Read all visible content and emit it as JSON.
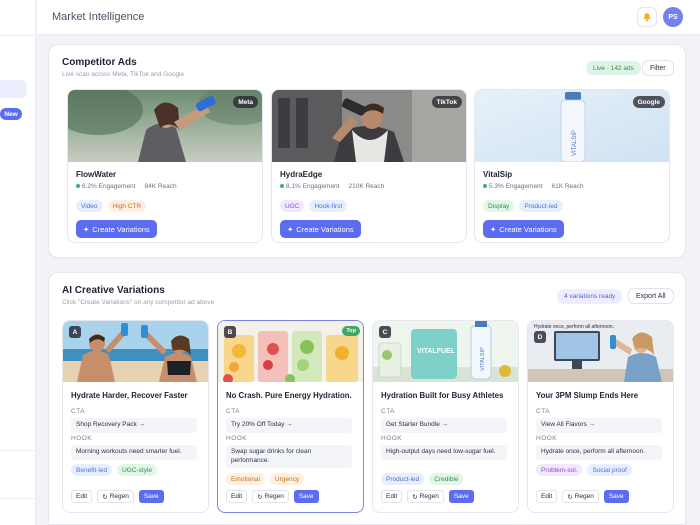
{
  "sidebar": {
    "new_badge": "New"
  },
  "header": {
    "title": "Market Intelligence",
    "avatar_initials": "PS",
    "bell_icon": "bell-icon"
  },
  "competitor_ads": {
    "title": "Competitor Ads",
    "subtitle": "Live scan across Meta, TikTok and Google",
    "live_badge": "Live · 142 ads",
    "filter_label": "Filter",
    "cards": [
      {
        "platform": "Meta",
        "brand": "FlowWater",
        "engagement": "6.2% Engagement",
        "reach": "84K Reach",
        "tags": [
          "Video",
          "High CTR"
        ],
        "cta": "Create Variations"
      },
      {
        "platform": "TikTok",
        "brand": "HydraEdge",
        "engagement": "8.1% Engagement",
        "reach": "210K Reach",
        "tags": [
          "UGC",
          "Hook-first"
        ],
        "cta": "Create Variations"
      },
      {
        "platform": "Google",
        "brand": "VitalSip",
        "engagement": "5.3% Engagement",
        "reach": "61K Reach",
        "tags": [
          "Display",
          "Product-led"
        ],
        "cta": "Create Variations"
      }
    ]
  },
  "variations": {
    "title": "AI Creative Variations",
    "subtitle": "Click \"Create Variations\" on any competitor ad above",
    "count_badge": "4 variations ready",
    "export_label": "Export All",
    "cta_label": "CTA",
    "hook_label": "HOOK",
    "edit_label": "Edit",
    "regen_label": "Regen",
    "save_label": "Save",
    "top_badge": "Top",
    "cards": [
      {
        "letter": "A",
        "headline": "Hydrate Harder, Recover Faster",
        "cta": "Shop Recovery Pack →",
        "hook": "Morning workouts need smarter fuel.",
        "tags": [
          "Benefit-led",
          "UGC-style"
        ]
      },
      {
        "letter": "B",
        "headline": "No Crash. Pure Energy Hydration.",
        "cta": "Try 20% Off Today →",
        "hook": "Swap sugar drinks for clean performance.",
        "tags": [
          "Emotional",
          "Urgency"
        ]
      },
      {
        "letter": "C",
        "headline": "Hydration Built for Busy Athletes",
        "cta": "Get Starter Bundle →",
        "hook": "High-output days need low-sugar fuel.",
        "tags": [
          "Product-led",
          "Credible"
        ],
        "image_text_1": "VITALFUEL",
        "image_text_2": "VITALSIP"
      },
      {
        "letter": "D",
        "headline": "Your 3PM Slump Ends Here",
        "cta": "View All Flavors →",
        "hook": "Hydrate once, perform all afternoon.",
        "tags": [
          "Problem-sol.",
          "Social proof"
        ],
        "image_caption": "Hydrate once, perform all afternoon."
      }
    ]
  },
  "colors": {
    "accent": "#5b6cf0",
    "live_green": "#2f8d55",
    "page_bg": "#f2f3f8"
  }
}
